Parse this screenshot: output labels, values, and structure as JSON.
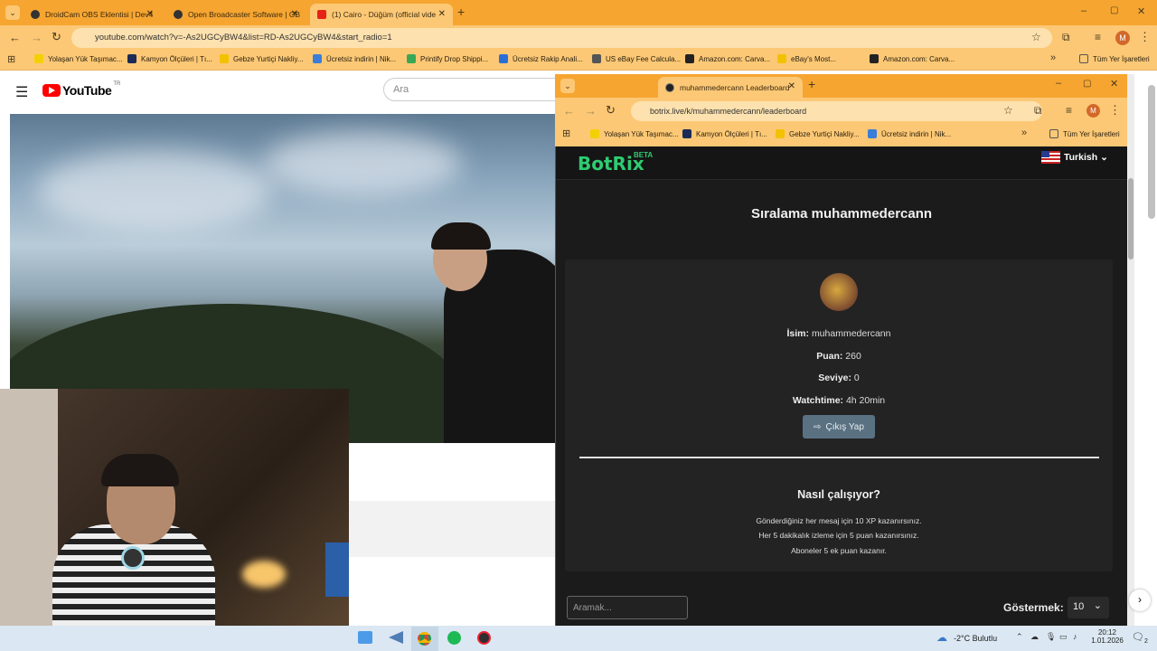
{
  "back_tabs": [
    {
      "label": "DroidCam OBS Eklentisi | Dev4",
      "icon_color": "#333"
    },
    {
      "label": "Open Broadcaster Software | OB",
      "icon_color": "#333"
    },
    {
      "label": "(1) Cairo - Düğüm (official vide",
      "icon_color": "#e62117"
    }
  ],
  "back_url": "youtube.com/watch?v=-As2UGCyBW4&list=RD-As2UGCyBW4&start_radio=1",
  "bookmarks": [
    {
      "label": "Yolaşan Yük Taşımac...",
      "color": "#f4d000"
    },
    {
      "label": "Kamyon Ölçüleri | Tı...",
      "color": "#1b2a57"
    },
    {
      "label": "Gebze Yurtiçi Nakliy...",
      "color": "#f2c200"
    },
    {
      "label": "Ücretsiz indirin | Nik...",
      "color": "#3b7dd8"
    },
    {
      "label": "Printify Drop Shippi...",
      "color": "#39a856"
    },
    {
      "label": "Ücretsiz Rakip Anali...",
      "color": "#2a6fd8"
    },
    {
      "label": "US eBay Fee Calcula...",
      "color": "#555"
    },
    {
      "label": "Amazon.com: Carva...",
      "color": "#222"
    },
    {
      "label": "eBay's Most...",
      "color": "#f2c200"
    },
    {
      "label": "Amazon.com: Carva...",
      "color": "#222"
    }
  ],
  "bookmarks_all": "Tüm Yer İşaretleri",
  "youtube": {
    "logo": "YouTube",
    "region": "TR",
    "search_placeholder": "Ara"
  },
  "front": {
    "tab_label": "muhammedercann Leaderboard",
    "url": "botrix.live/k/muhammedercann/leaderboard",
    "bookmarks": [
      {
        "label": "Yolaşan Yük Taşımac...",
        "color": "#f4d000"
      },
      {
        "label": "Kamyon Ölçüleri | Tı...",
        "color": "#1b2a57"
      },
      {
        "label": "Gebze Yurtiçi Nakliy...",
        "color": "#f2c200"
      },
      {
        "label": "Ücretsiz indirin | Nik...",
        "color": "#3b7dd8"
      }
    ],
    "bookmarks_all": "Tüm Yer İşaretleri"
  },
  "botrix": {
    "logo": "BotRix",
    "beta": "BETA",
    "language": "Turkish",
    "heading": "Sıralama muhammedercann",
    "name_label": "İsim:",
    "name_value": "muhammedercann",
    "points_label": "Puan:",
    "points_value": "260",
    "level_label": "Seviye:",
    "level_value": "0",
    "watch_label": "Watchtime:",
    "watch_value": "4h 20min",
    "logout": "Çıkış Yap",
    "how_title": "Nasıl çalışıyor?",
    "how_lines": [
      "Gönderdiğiniz her mesaj için 10 XP kazanırsınız.",
      "Her 5 dakikalık izleme için 5 puan kazanırsınız.",
      "Aboneler 5 ek puan kazanır."
    ],
    "search_placeholder": "Aramak...",
    "show_label": "Göstermek:",
    "show_value": "10"
  },
  "taskbar": {
    "weather": "-2°C Bulutlu",
    "time": "20:12",
    "date": "1.01.2026",
    "notif": "2"
  },
  "colors": {
    "orange": "#f6a531",
    "botrix_green": "#2ecc71"
  }
}
